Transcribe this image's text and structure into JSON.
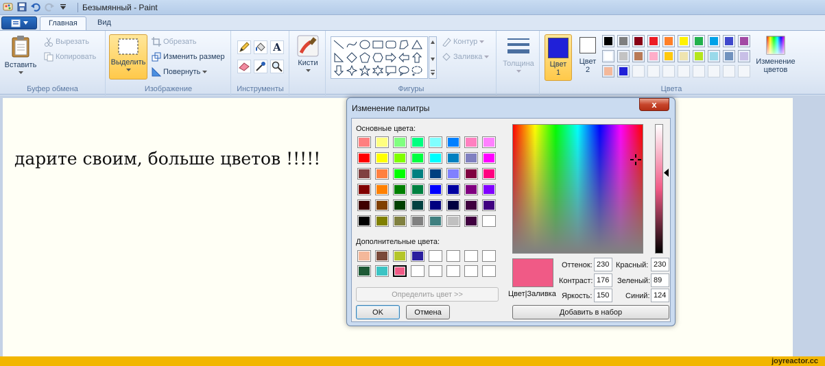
{
  "window": {
    "title": "Безымянный - Paint"
  },
  "tabs": [
    {
      "label": "Главная",
      "active": true
    },
    {
      "label": "Вид",
      "active": false
    }
  ],
  "ribbon": {
    "clipboard": {
      "label": "Буфер обмена",
      "paste": "Вставить",
      "cut": "Вырезать",
      "copy": "Копировать"
    },
    "image": {
      "label": "Изображение",
      "select": "Выделить",
      "crop": "Обрезать",
      "resize": "Изменить размер",
      "rotate": "Повернуть"
    },
    "tools": {
      "label": "Инструменты"
    },
    "brushes": {
      "label": "Кисти"
    },
    "shapes": {
      "label": "Фигуры",
      "outline": "Контур",
      "fill": "Заливка"
    },
    "thickness": {
      "label": "Толщина"
    },
    "colors": {
      "label": "Цвета",
      "color1": "Цвет 1",
      "color2": "Цвет 2",
      "color1_value": "#2020d8",
      "color2_value": "#ffffff",
      "edit": "Изменение цветов",
      "palette": [
        [
          "#000000",
          "#7f7f7f",
          "#880015",
          "#ed1c24",
          "#ff7f27",
          "#fff200",
          "#22b14c",
          "#00a2e8",
          "#3f48cc",
          "#a349a4"
        ],
        [
          "#ffffff",
          "#c3c3c3",
          "#b97a57",
          "#ffaec9",
          "#ffc90e",
          "#efe4b0",
          "#b5e61d",
          "#99d9ea",
          "#7092be",
          "#c8bfe7"
        ],
        [
          "#f4b89a",
          "#2020d8",
          "",
          "",
          "",
          "",
          "",
          "",
          "",
          ""
        ]
      ]
    }
  },
  "canvas": {
    "text": "дарите своим, больше цветов !!!!!"
  },
  "dialog": {
    "title": "Изменение палитры",
    "close": "x",
    "basic_label": "Основные цвета:",
    "custom_label": "Дополнительные цвета:",
    "basic_colors": [
      [
        "#ff8080",
        "#ffff80",
        "#80ff80",
        "#00ff80",
        "#80ffff",
        "#0080ff",
        "#ff80c0",
        "#ff80ff"
      ],
      [
        "#ff0000",
        "#ffff00",
        "#80ff00",
        "#00ff40",
        "#00ffff",
        "#0080c0",
        "#8080c0",
        "#ff00ff"
      ],
      [
        "#804040",
        "#ff8040",
        "#00ff00",
        "#008080",
        "#004080",
        "#8080ff",
        "#800040",
        "#ff0080"
      ],
      [
        "#800000",
        "#ff8000",
        "#008000",
        "#008040",
        "#0000ff",
        "#0000a0",
        "#800080",
        "#8000ff"
      ],
      [
        "#400000",
        "#804000",
        "#004000",
        "#004040",
        "#000080",
        "#000040",
        "#400040",
        "#400080"
      ],
      [
        "#000000",
        "#808000",
        "#808040",
        "#808080",
        "#408080",
        "#c0c0c0",
        "#400040",
        "#ffffff"
      ]
    ],
    "custom_colors": [
      [
        "#f4b89a",
        "#7a4a3a",
        "#b5c62a",
        "#2a1e9e",
        "#ffffff",
        "#ffffff",
        "#ffffff",
        "#ffffff"
      ],
      [
        "#1e5a36",
        "#3cc4c4",
        "#f05a86",
        "#ffffff",
        "#ffffff",
        "#ffffff",
        "#ffffff",
        "#ffffff"
      ]
    ],
    "define_button": "Определить цвет >>",
    "ok": "OK",
    "cancel": "Отмена",
    "preview_label": "Цвет|Заливка",
    "preview_color": "#f05a86",
    "hue_label": "Оттенок:",
    "hue": "230",
    "sat_label": "Контраст:",
    "sat": "176",
    "lum_label": "Яркость:",
    "lum": "150",
    "red_label": "Красный:",
    "red": "230",
    "green_label": "Зеленый:",
    "green": "89",
    "blue_label": "Синий:",
    "blue": "124",
    "add_button": "Добавить в набор"
  },
  "watermark": "joyreactor.cc"
}
